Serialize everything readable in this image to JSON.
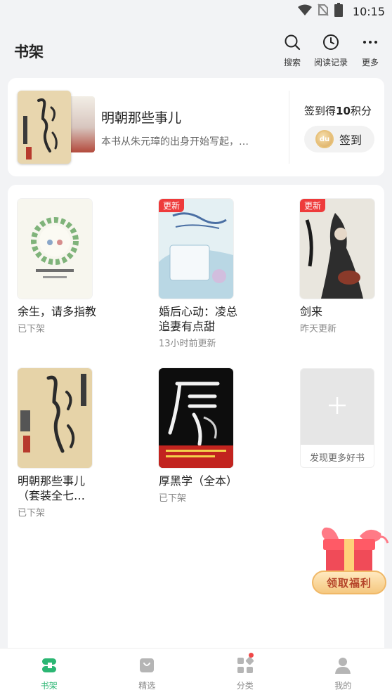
{
  "status_bar": {
    "time": "10:15"
  },
  "header": {
    "title": "书架",
    "actions": [
      {
        "label": "搜索",
        "icon": "search-icon"
      },
      {
        "label": "阅读记录",
        "icon": "clock-icon"
      },
      {
        "label": "更多",
        "icon": "more-icon"
      }
    ]
  },
  "reading": {
    "title": "明朝那些事儿",
    "description": "本书从朱元璋的出身开始写起，…",
    "checkin_prefix": "签到得",
    "checkin_points": "10",
    "checkin_suffix": "积分",
    "checkin_button": "签到",
    "coin_text": "du"
  },
  "shelf": {
    "books": [
      {
        "title": "余生，请多指教",
        "status": "已下架",
        "badge": ""
      },
      {
        "title": "婚后心动：凌总追妻有点甜",
        "status": "13小时前更新",
        "badge": "更新"
      },
      {
        "title": "剑来",
        "status": "昨天更新",
        "badge": "更新"
      },
      {
        "title": "明朝那些事儿（套装全七…",
        "status": "已下架",
        "badge": ""
      },
      {
        "title": "厚黑学（全本）",
        "status": "已下架",
        "badge": ""
      }
    ],
    "add_more": {
      "label": "发现更多好书",
      "icon": "plus-icon"
    }
  },
  "reward": {
    "label": "领取福利",
    "icon": "gift-icon"
  },
  "tabs": [
    {
      "label": "书架",
      "icon": "bookshelf-icon",
      "active": true
    },
    {
      "label": "精选",
      "icon": "bag-icon",
      "active": false
    },
    {
      "label": "分类",
      "icon": "category-icon",
      "active": false
    },
    {
      "label": "我的",
      "icon": "person-icon",
      "active": false
    }
  ],
  "colors": {
    "accent": "#2bb673",
    "badge": "#ee3b3b",
    "background": "#f2f3f5"
  }
}
